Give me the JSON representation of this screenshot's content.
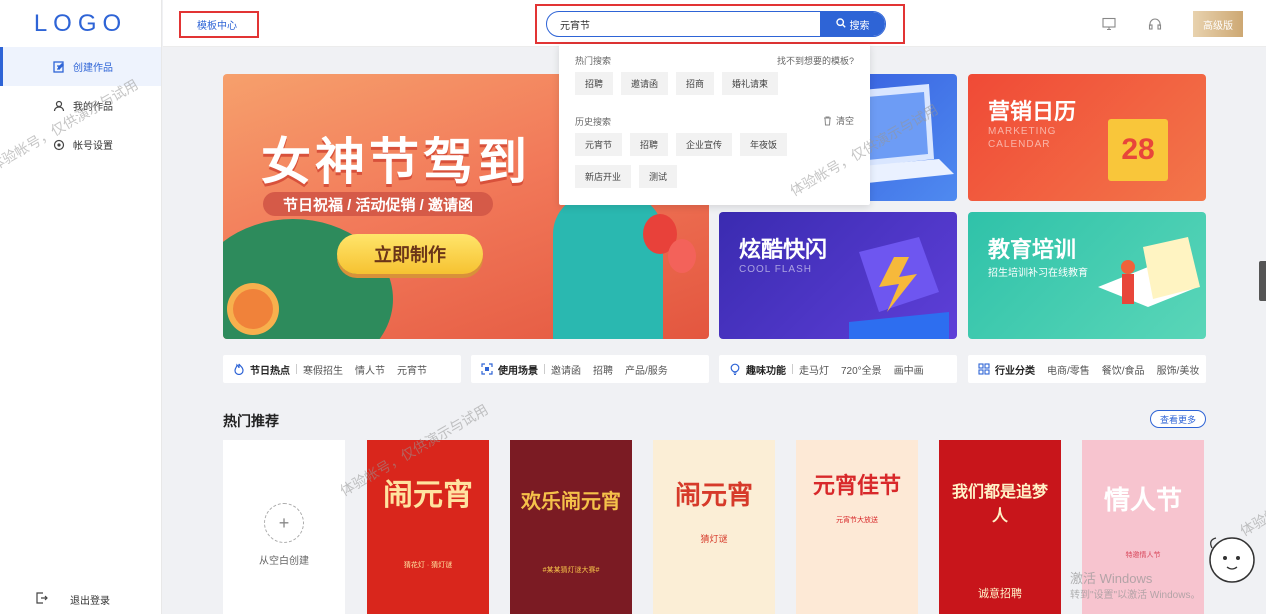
{
  "logo": "LOGO",
  "sidebar": {
    "items": [
      {
        "label": "创建作品",
        "icon": "edit-icon",
        "active": true
      },
      {
        "label": "我的作品",
        "icon": "user-icon",
        "active": false
      },
      {
        "label": "帐号设置",
        "icon": "settings-icon",
        "active": false
      }
    ],
    "logout": "退出登录"
  },
  "topbar": {
    "template_center": "模板中心",
    "search_value": "元宵节",
    "search_button": "搜索",
    "vip_label": "高级版"
  },
  "dropdown": {
    "hot_label": "热门搜索",
    "not_found": "找不到想要的模板?",
    "hot_tags": [
      "招聘",
      "邀请函",
      "招商",
      "婚礼请柬"
    ],
    "history_label": "历史搜索",
    "clear_label": "清空",
    "history_tags_row1": [
      "元宵节",
      "招聘",
      "企业宣传",
      "年夜饭"
    ],
    "history_tags_row2": [
      "新店开业",
      "测试"
    ]
  },
  "banner": {
    "title": "女神节驾到",
    "subtitle": "节日祝福 / 活动促销 / 邀请函",
    "button": "立即制作"
  },
  "tiles": [
    {
      "title": "",
      "en": "",
      "sub": ""
    },
    {
      "title": "营销日历",
      "en": "MARKETING",
      "en2": "CALENDAR",
      "num": "28"
    },
    {
      "title": "炫酷快闪",
      "en": "COOL FLASH"
    },
    {
      "title": "教育培训",
      "sub": "招生培训补习在线教育"
    }
  ],
  "categories": [
    {
      "title": "节日热点",
      "icon": "fire-icon",
      "tags": [
        "寒假招生",
        "情人节",
        "元宵节"
      ]
    },
    {
      "title": "使用场景",
      "icon": "scan-icon",
      "tags": [
        "邀请函",
        "招聘",
        "产品/服务"
      ]
    },
    {
      "title": "趣味功能",
      "icon": "bulb-icon",
      "tags": [
        "走马灯",
        "720°全景",
        "画中画"
      ]
    },
    {
      "title": "行业分类",
      "icon": "grid-icon",
      "tags": [
        "电商/零售",
        "餐饮/食品",
        "服饰/美妆"
      ]
    }
  ],
  "hot": {
    "title": "热门推荐",
    "more": "查看更多",
    "blank_label": "从空白创建"
  },
  "posters": [
    {
      "title": "闹元宵",
      "sub": "猜花灯 · 猜灯谜",
      "bg": "#d9261c",
      "fg": "#ffe3a0"
    },
    {
      "title": "欢乐闹元宵",
      "sub": "#某某猜灯谜大赛#",
      "bg": "#7b1b23",
      "fg": "#f5c14a"
    },
    {
      "title": "闹元宵",
      "sub": "猜灯谜",
      "bg": "#fbeed6",
      "fg": "#d63a2a"
    },
    {
      "title": "元宵佳节",
      "sub": "元宵节大放送",
      "bg": "#fde9d6",
      "fg": "#d8282a"
    },
    {
      "title": "我们都是追梦人",
      "sub": "诚意招聘",
      "bg": "#c8151b",
      "fg": "#fff2c8"
    },
    {
      "title": "情人节",
      "sub": "特邀情人节",
      "bg": "#f7c4cf",
      "fg": "#ffffff"
    }
  ],
  "watermark": "体验帐号，仅供演示与试用",
  "activation": {
    "line1": "激活 Windows",
    "line2": "转到\"设置\"以激活 Windows。"
  },
  "colors": {
    "accent": "#2e64d6",
    "highlight": "#e23434"
  }
}
